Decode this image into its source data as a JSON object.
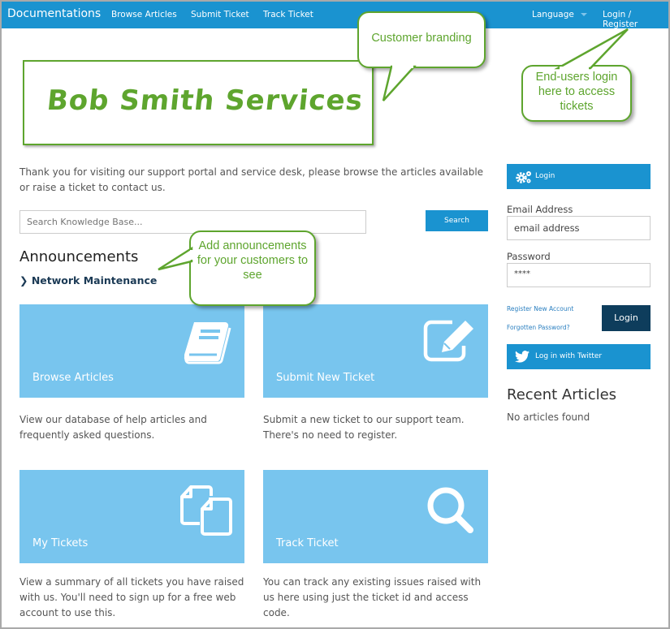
{
  "navbar": {
    "brand": "Documentations",
    "links": [
      "Browse Articles",
      "Submit Ticket",
      "Track Ticket"
    ],
    "language": "Language",
    "login_register": "Login / Register"
  },
  "branding": {
    "logo_text": "Bob Smith Services"
  },
  "callouts": {
    "branding": "Customer branding",
    "login": "End-users login here to access tickets",
    "announcements": "Add announcements for your customers to see"
  },
  "intro_text": "Thank you for visiting our support portal and service desk, please browse the articles available or raise a ticket to contact us.",
  "search": {
    "placeholder": "Search Knowledge Base...",
    "button": "Search"
  },
  "announcements": {
    "title": "Announcements",
    "items": [
      "Network Maintenance"
    ]
  },
  "tiles": [
    {
      "label": "Browse Articles",
      "icon": "book-icon",
      "description": "View our database of help articles and frequently asked questions."
    },
    {
      "label": "Submit New Ticket",
      "icon": "edit-icon",
      "description": "Submit a new ticket to our support team. There's no need to register."
    },
    {
      "label": "My Tickets",
      "icon": "copy-icon",
      "description": "View a summary of all tickets you have raised with us. You'll need to sign up for a free web account to use this."
    },
    {
      "label": "Track Ticket",
      "icon": "search-icon",
      "description": "You can track any existing issues raised with us here using just the ticket id and access code."
    }
  ],
  "login_panel": {
    "header": "Login",
    "email_label": "Email Address",
    "email_value": "email address",
    "password_label": "Password",
    "password_value": "****",
    "register_link": "Register New Account",
    "forgot_link": "Forgotten Password?",
    "login_button": "Login",
    "twitter_button": "Log in with Twitter"
  },
  "recent_articles": {
    "title": "Recent Articles",
    "empty": "No articles found"
  },
  "colors": {
    "primary": "#1a93d0",
    "tile": "#78c5ee",
    "dark_button": "#0e3d5c",
    "callout_green": "#5ea52e"
  }
}
